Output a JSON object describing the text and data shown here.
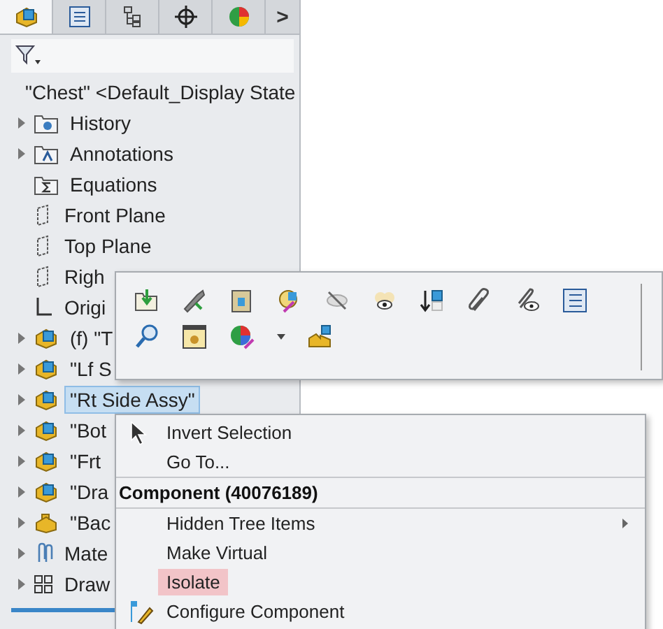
{
  "tabs": [
    {
      "kind": "assembly",
      "selected": true
    },
    {
      "kind": "list",
      "selected": false
    },
    {
      "kind": "tree",
      "selected": false
    },
    {
      "kind": "target",
      "selected": false
    },
    {
      "kind": "appearance",
      "selected": false
    }
  ],
  "tabs_more": ">",
  "tree_root": {
    "label": "\"Chest\" <Default_Display State"
  },
  "tree": [
    {
      "label": "History",
      "kind": "history",
      "expandable": true,
      "selected": false
    },
    {
      "label": "Annotations",
      "kind": "annotations",
      "expandable": true,
      "selected": false
    },
    {
      "label": "Equations",
      "kind": "equations",
      "expandable": false,
      "selected": false
    },
    {
      "label": "Front Plane",
      "kind": "plane",
      "expandable": false,
      "selected": false
    },
    {
      "label": "Top Plane",
      "kind": "plane",
      "expandable": false,
      "selected": false
    },
    {
      "label": "Righ",
      "kind": "plane",
      "expandable": false,
      "selected": false
    },
    {
      "label": "Origi",
      "kind": "origin",
      "expandable": false,
      "selected": false
    },
    {
      "label": "(f) \"T",
      "kind": "assembly",
      "expandable": true,
      "selected": false
    },
    {
      "label": "\"Lf S",
      "kind": "assembly",
      "expandable": true,
      "selected": false
    },
    {
      "label": "\"Rt Side Assy\"",
      "kind": "assembly",
      "expandable": true,
      "selected": true
    },
    {
      "label": "\"Bot",
      "kind": "assembly",
      "expandable": true,
      "selected": false
    },
    {
      "label": "\"Frt",
      "kind": "assembly",
      "expandable": true,
      "selected": false
    },
    {
      "label": "\"Dra",
      "kind": "assembly",
      "expandable": true,
      "selected": false
    },
    {
      "label": "\"Bac",
      "kind": "part",
      "expandable": true,
      "selected": false
    },
    {
      "label": "Mate",
      "kind": "mates",
      "expandable": true,
      "selected": false
    },
    {
      "label": "Draw",
      "kind": "drawings",
      "expandable": true,
      "selected": false
    }
  ],
  "menu": [
    {
      "kind": "pointer",
      "label": "Invert Selection",
      "selected": false,
      "submenu": false
    },
    {
      "kind": "item",
      "label": "Go To...",
      "selected": false,
      "submenu": false
    },
    {
      "kind": "header",
      "label": "Component (40076189)"
    },
    {
      "kind": "item",
      "label": "Hidden Tree Items",
      "selected": false,
      "submenu": true
    },
    {
      "kind": "item",
      "label": "Make Virtual",
      "selected": false,
      "submenu": false
    },
    {
      "kind": "item",
      "label": "Isolate",
      "selected": true,
      "submenu": false
    },
    {
      "kind": "configure",
      "label": "Configure Component",
      "selected": false,
      "submenu": false
    }
  ]
}
